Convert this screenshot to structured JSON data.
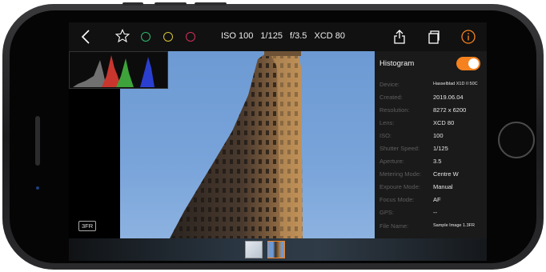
{
  "toolbar": {
    "exif": {
      "iso": "ISO 100",
      "shutter": "1/125",
      "aperture": "f/3.5",
      "lens": "XCD 80"
    },
    "colors": {
      "rating_green": "#2fb86b",
      "rating_yellow": "#d6c43a",
      "rating_red": "#d0305a",
      "accent": "#f5821f"
    }
  },
  "histogram": {
    "series": [
      "gray",
      "red",
      "green",
      "blue"
    ]
  },
  "format_badge": "3FR",
  "info_panel": {
    "title": "Histogram",
    "toggle_on": true,
    "rows": [
      {
        "label": "Device:",
        "value": "Hasselblad X1D II 50C"
      },
      {
        "label": "Created:",
        "value": "2019.06.04"
      },
      {
        "label": "Resolution:",
        "value": "8272 x 6200"
      },
      {
        "label": "Lens:",
        "value": "XCD 80"
      },
      {
        "label": "ISO:",
        "value": "100"
      },
      {
        "label": "Shutter Speed:",
        "value": "1/125"
      },
      {
        "label": "Aperture:",
        "value": "3.5"
      },
      {
        "label": "Metering Mode:",
        "value": "Centre W"
      },
      {
        "label": "Expoure Mode:",
        "value": "Manual"
      },
      {
        "label": "Focus Mode:",
        "value": "AF"
      },
      {
        "label": "GPS:",
        "value": "--"
      },
      {
        "label": "File Name:",
        "value": "Sample Image 1.3FR"
      }
    ]
  },
  "filmstrip": {
    "count": 2,
    "selected_index": 1
  }
}
